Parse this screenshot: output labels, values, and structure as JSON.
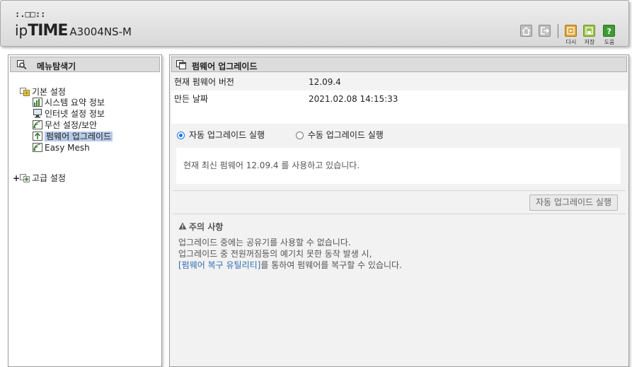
{
  "header": {
    "brand_dots": ":.□□::",
    "brand_ip": "ip",
    "brand_time": "TIME",
    "model": "A3004NS-M",
    "buttons": [
      {
        "name": "home",
        "icon": "home-icon"
      },
      {
        "name": "logout",
        "icon": "logout-icon"
      },
      {
        "name": "restart",
        "label": "다시",
        "icon": "restart-icon",
        "color": "#e0a63b"
      },
      {
        "name": "save",
        "label": "저장",
        "icon": "save-icon",
        "color": "#9bc34b"
      },
      {
        "name": "help",
        "label": "도움",
        "icon": "help-icon",
        "color": "#3e9b34"
      }
    ]
  },
  "sidebar": {
    "title": "메뉴탐색기",
    "groups": [
      {
        "label": "기본 설정",
        "expanded": true,
        "items": [
          {
            "label": "시스템 요약 정보",
            "icon": "chart-icon"
          },
          {
            "label": "인터넷 설정 정보",
            "icon": "monitor-icon"
          },
          {
            "label": "무선 설정/보안",
            "icon": "wireless-icon"
          },
          {
            "label": "펌웨어 업그레이드",
            "icon": "upgrade-icon",
            "selected": true
          },
          {
            "label": "Easy Mesh",
            "icon": "wireless-icon"
          }
        ]
      },
      {
        "label": "고급 설정",
        "expanded": false,
        "toggle": "+"
      }
    ]
  },
  "main": {
    "title": "펌웨어 업그레이드",
    "info": [
      {
        "label": "현재 펌웨어 버전",
        "value": "12.09.4"
      },
      {
        "label": "만든 날짜",
        "value": "2021.02.08 14:15:33"
      }
    ],
    "radio_auto": "자동 업그레이드 실행",
    "radio_manual": "수동 업그레이드 실행",
    "selected_mode": "auto",
    "status": "현재 최신 펌웨어 12.09.4 를 사용하고 있습니다.",
    "run_button": "자동 업그레이드 실행",
    "caution": {
      "title": "주의 사항",
      "line1": "업그레이드 중에는 공유기를 사용할 수 없습니다.",
      "line2": "업그레이드 중 전원꺼짐등의 예기치 못한 동작 발생 시,",
      "link": "[펌웨어 복구 유틸리티]",
      "line3_rest": "를 통하여 펌웨어를 복구할 수 있습니다."
    }
  }
}
